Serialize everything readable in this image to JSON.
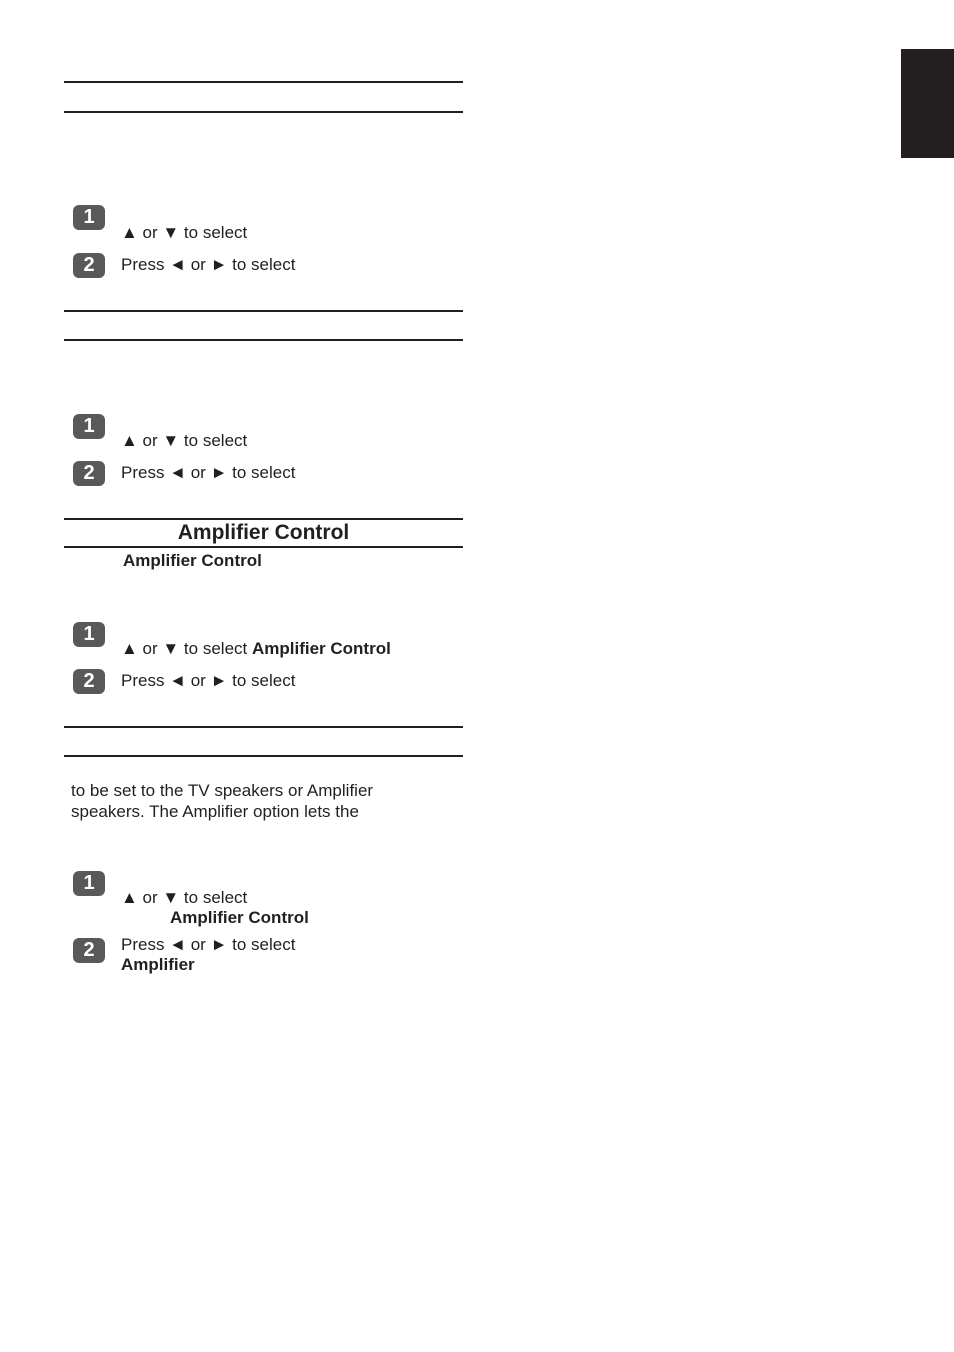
{
  "page": {
    "side_tab_color": "#231f20"
  },
  "sections": [
    {
      "heading": "",
      "steps": [
        {
          "number": "1",
          "text": "▲ or ▼ to select",
          "bold": ""
        },
        {
          "number": "2",
          "text": "Press ◄ or ► to select",
          "bold": ""
        }
      ]
    },
    {
      "heading": "",
      "steps": [
        {
          "number": "1",
          "text": "▲ or ▼ to select",
          "bold": ""
        },
        {
          "number": "2",
          "text": "Press ◄ or ► to select",
          "bold": ""
        }
      ]
    },
    {
      "heading": "Amplifier Control",
      "subheading": "Amplifier Control",
      "steps": [
        {
          "number": "1",
          "text": "▲ or ▼ to select ",
          "bold": "Amplifier Control"
        },
        {
          "number": "2",
          "text": "Press ◄ or ► to select",
          "bold": ""
        }
      ]
    },
    {
      "heading": "",
      "paragraph": [
        "to be set to the TV speakers or Amplifier",
        "speakers. The Amplifier option lets the"
      ],
      "steps": [
        {
          "number": "1",
          "text": "▲ or ▼ to select",
          "bold": "Amplifier Control"
        },
        {
          "number": "2",
          "text": "Press ◄ or ► to select",
          "bold": "Amplifier"
        }
      ]
    }
  ]
}
